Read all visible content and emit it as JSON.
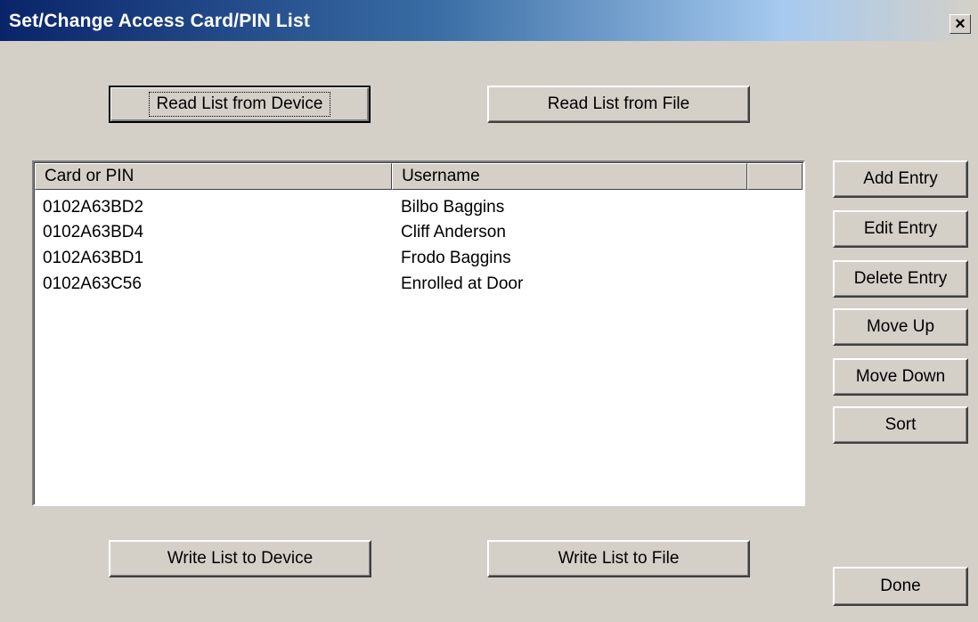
{
  "window": {
    "title": "Set/Change Access Card/PIN List",
    "close_glyph": "×"
  },
  "buttons": {
    "read_device": "Read List from Device",
    "read_file": "Read List from File",
    "write_device": "Write List to Device",
    "write_file": "Write List to File",
    "add_entry": "Add Entry",
    "edit_entry": "Edit Entry",
    "delete_entry": "Delete Entry",
    "move_up": "Move Up",
    "move_down": "Move Down",
    "sort": "Sort",
    "done": "Done"
  },
  "list": {
    "columns": [
      "Card or PIN",
      "Username",
      ""
    ],
    "rows": [
      {
        "card": "0102A63BD2",
        "user": "Bilbo Baggins"
      },
      {
        "card": "0102A63BD4",
        "user": "Cliff Anderson"
      },
      {
        "card": "0102A63BD1",
        "user": "Frodo Baggins"
      },
      {
        "card": "0102A63C56",
        "user": "Enrolled at Door"
      }
    ]
  }
}
